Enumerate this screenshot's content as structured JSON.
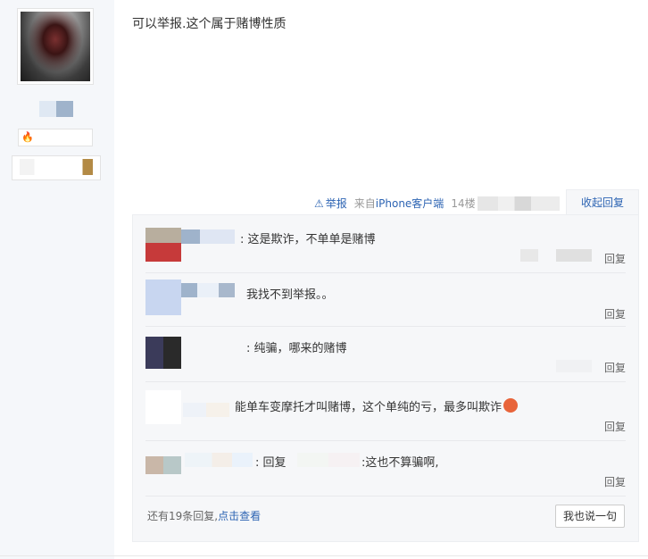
{
  "post": {
    "content": "可以举报.这个属于赌博性质",
    "report_label": "举报",
    "source_prefix": "来自",
    "source_link": "iPhone客户端",
    "floor": "14楼",
    "collapse_label": "收起回复"
  },
  "replies": [
    {
      "text": ": 这是欺诈，不单单是赌博",
      "reply_label": "回复"
    },
    {
      "text": "我找不到举报。。",
      "reply_label": "回复"
    },
    {
      "text": ": 纯骗，哪来的赌博",
      "reply_label": "回复"
    },
    {
      "text": "能单车变摩托才叫赌博，这个单纯的亏，最多叫欺诈",
      "reply_label": "回复"
    },
    {
      "text_prefix": ": 回复",
      "text_suffix": ":这也不算骗啊,",
      "reply_label": "回复"
    }
  ],
  "footer": {
    "more_prefix": "还有19条回复,",
    "more_link": "点击查看",
    "say_button": "我也说一句"
  },
  "icons": {
    "report": "warning-triangle-icon",
    "emoji": "angry-face-emoji-icon",
    "badge": "fire-badge-icon"
  }
}
